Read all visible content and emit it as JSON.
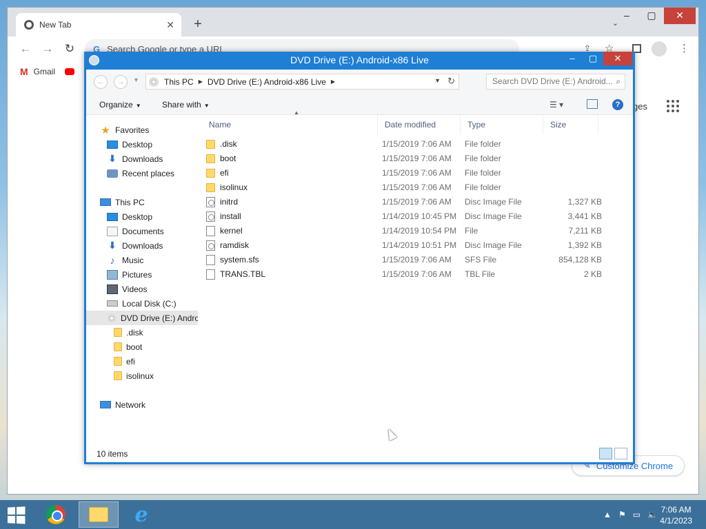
{
  "chrome": {
    "tab_title": "New Tab",
    "omnibox_placeholder": "Search Google or type a URL",
    "bookmarks": [
      {
        "label": "Gmail"
      }
    ],
    "images_link": "Images",
    "customize_label": "Customize Chrome"
  },
  "explorer": {
    "title": "DVD Drive (E:) Android-x86 Live",
    "breadcrumb": [
      "This PC",
      "DVD Drive (E:) Android-x86 Live"
    ],
    "search_placeholder": "Search DVD Drive (E:) Android...",
    "toolbar": {
      "organize": "Organize",
      "share_with": "Share with"
    },
    "columns": {
      "name": "Name",
      "date": "Date modified",
      "type": "Type",
      "size": "Size"
    },
    "nav": {
      "favorites": "Favorites",
      "fav_desktop": "Desktop",
      "fav_downloads": "Downloads",
      "fav_recent": "Recent places",
      "this_pc": "This PC",
      "pc_desktop": "Desktop",
      "pc_documents": "Documents",
      "pc_downloads": "Downloads",
      "pc_music": "Music",
      "pc_pictures": "Pictures",
      "pc_videos": "Videos",
      "pc_local_disk": "Local Disk (C:)",
      "pc_dvd": "DVD Drive (E:) Andro",
      "sub_disk": ".disk",
      "sub_boot": "boot",
      "sub_efi": "efi",
      "sub_isolinux": "isolinux",
      "network": "Network"
    },
    "files": [
      {
        "name": ".disk",
        "date": "1/15/2019 7:06 AM",
        "type": "File folder",
        "size": "",
        "icon": "folder"
      },
      {
        "name": "boot",
        "date": "1/15/2019 7:06 AM",
        "type": "File folder",
        "size": "",
        "icon": "folder"
      },
      {
        "name": "efi",
        "date": "1/15/2019 7:06 AM",
        "type": "File folder",
        "size": "",
        "icon": "folder"
      },
      {
        "name": "isolinux",
        "date": "1/15/2019 7:06 AM",
        "type": "File folder",
        "size": "",
        "icon": "folder"
      },
      {
        "name": "initrd",
        "date": "1/15/2019 7:06 AM",
        "type": "Disc Image File",
        "size": "1,327 KB",
        "icon": "disc"
      },
      {
        "name": "install",
        "date": "1/14/2019 10:45 PM",
        "type": "Disc Image File",
        "size": "3,441 KB",
        "icon": "disc"
      },
      {
        "name": "kernel",
        "date": "1/14/2019 10:54 PM",
        "type": "File",
        "size": "7,211 KB",
        "icon": "plain"
      },
      {
        "name": "ramdisk",
        "date": "1/14/2019 10:51 PM",
        "type": "Disc Image File",
        "size": "1,392 KB",
        "icon": "disc"
      },
      {
        "name": "system.sfs",
        "date": "1/15/2019 7:06 AM",
        "type": "SFS File",
        "size": "854,128 KB",
        "icon": "plain"
      },
      {
        "name": "TRANS.TBL",
        "date": "1/15/2019 7:06 AM",
        "type": "TBL File",
        "size": "2 KB",
        "icon": "plain"
      }
    ],
    "status": "10 items"
  },
  "taskbar": {
    "time": "7:06 AM",
    "date": "4/1/2023"
  },
  "colors": {
    "explorer_accent": "#1e7fd4",
    "close_red": "#c7423b",
    "chrome_link": "#1a73e8"
  }
}
